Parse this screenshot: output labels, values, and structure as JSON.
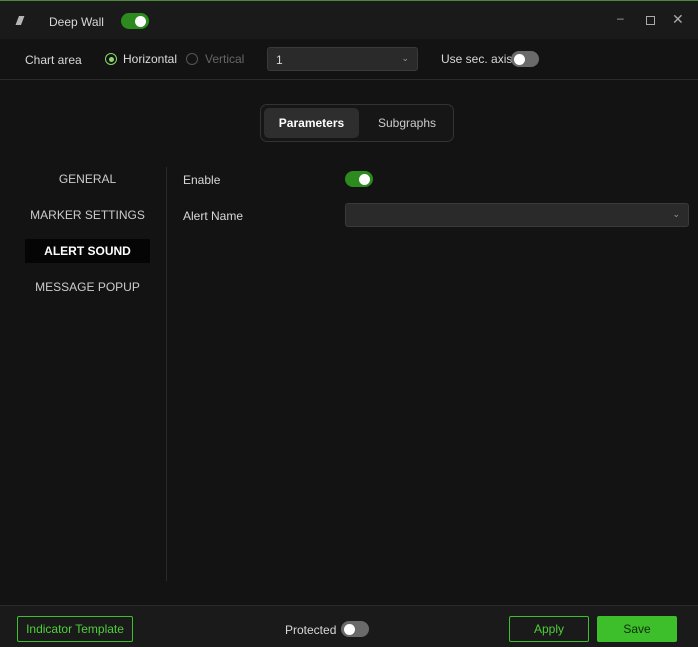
{
  "window": {
    "title": "Deep Wall",
    "enabled": true,
    "controls": [
      "minimize",
      "maximize",
      "close"
    ]
  },
  "chart_area": {
    "label": "Chart area",
    "options": [
      "Horizontal",
      "Vertical"
    ],
    "selected": "Horizontal",
    "select_value": "1",
    "sec_axis_label": "Use sec. axis",
    "sec_axis": false
  },
  "tabs": [
    {
      "label": "Parameters",
      "active": true
    },
    {
      "label": "Subgraphs",
      "active": false
    }
  ],
  "nav": [
    {
      "label": "GENERAL"
    },
    {
      "label": "MARKER SETTINGS"
    },
    {
      "label": "ALERT SOUND",
      "active": true
    },
    {
      "label": "MESSAGE POPUP"
    }
  ],
  "params": {
    "enable_label": "Enable",
    "enable": true,
    "alert_name_label": "Alert Name",
    "alert_name_value": ""
  },
  "footer": {
    "template_label": "Indicator Template",
    "protected_label": "Protected",
    "protected": false,
    "apply_label": "Apply",
    "save_label": "Save"
  },
  "colors": {
    "accent": "#3cbf2a",
    "toggle_on": "#2d8a1e"
  }
}
